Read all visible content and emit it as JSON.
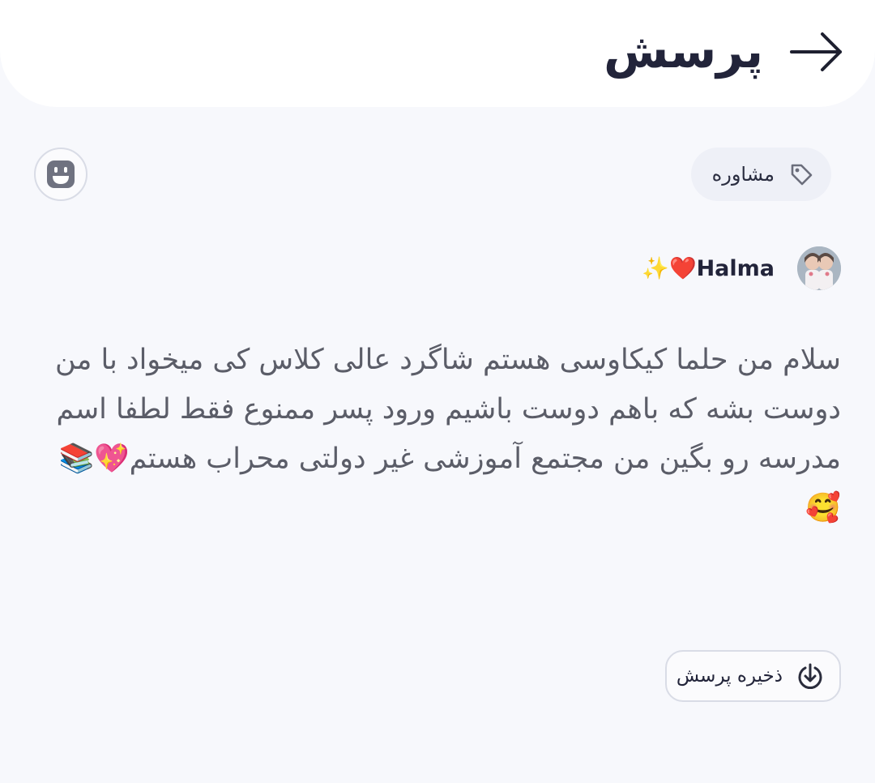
{
  "header": {
    "title": "پرسش",
    "back_icon": "arrow-right-icon"
  },
  "tag": {
    "label": "مشاوره",
    "icon": "tag-icon"
  },
  "reaction_button": {
    "icon": "smiley-icon"
  },
  "author": {
    "name": "✨❤️Halma",
    "avatar": "avatar-image"
  },
  "post": {
    "body": "سلام من حلما کیکاوسی هستم شاگرد عالی کلاس کی میخواد با من دوست بشه که باهم دوست باشیم ورود پسر ممنوع فقط لطفا اسم مدرسه رو بگین من مجتمع آموزشی غیر دولتی محراب هستم💖📚🥰"
  },
  "save_button": {
    "label": "ذخیره پرسش",
    "icon": "download-icon"
  },
  "colors": {
    "background": "#f7f8fc",
    "header_bg": "#ffffff",
    "title_text": "#22243a",
    "body_text": "#5b5d68",
    "chip_bg": "#eef0f7",
    "border": "#d9dce6"
  }
}
